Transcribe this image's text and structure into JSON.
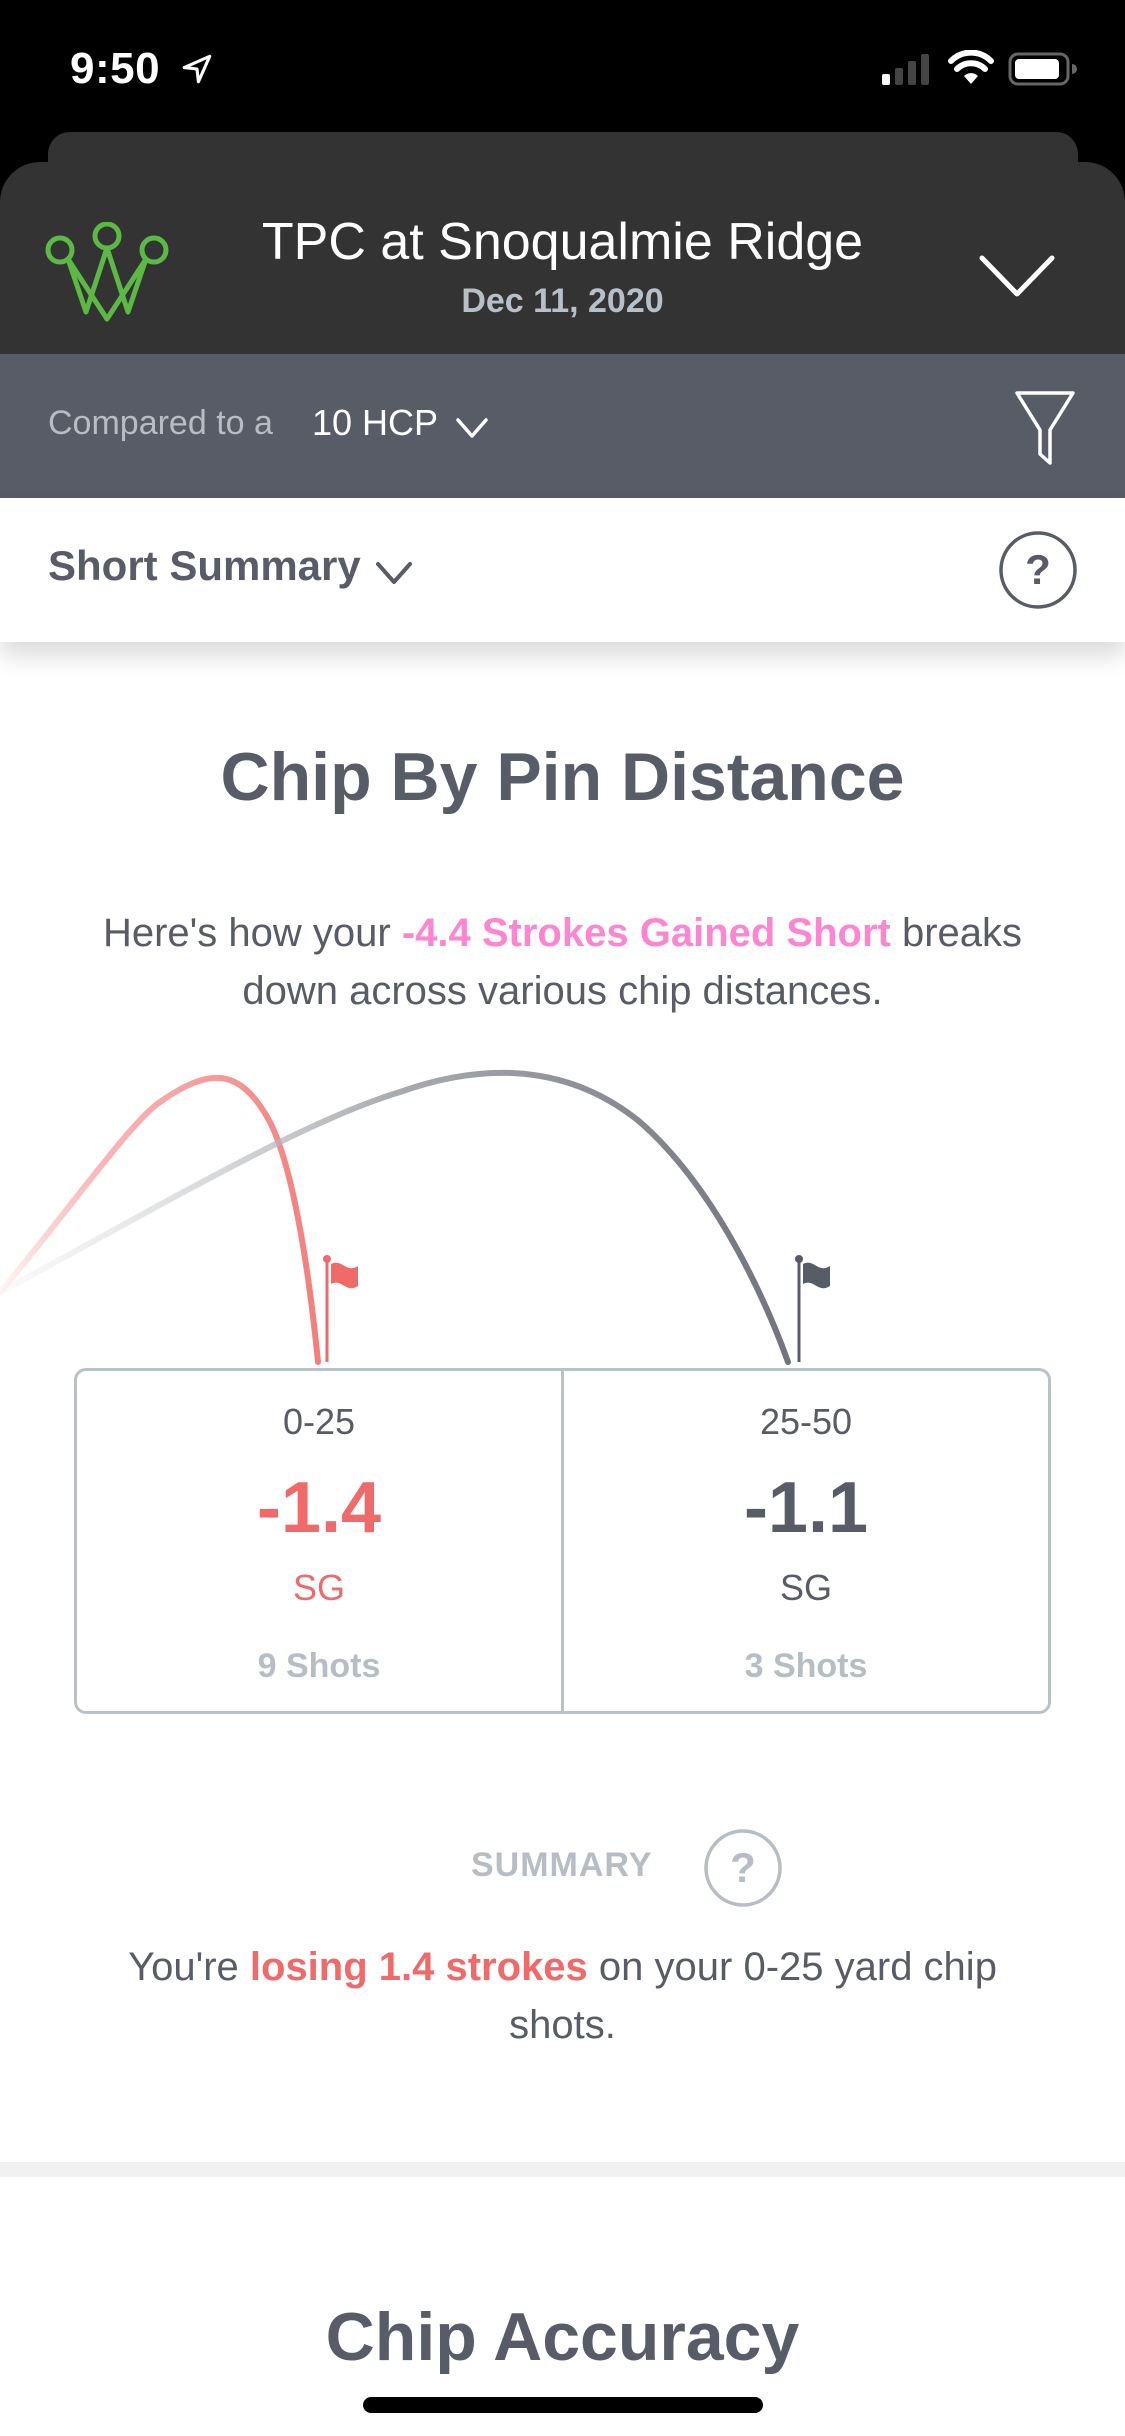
{
  "status_bar": {
    "time": "9:50",
    "icons": [
      "location-arrow-icon",
      "cellular-signal-icon",
      "wifi-icon",
      "battery-icon"
    ]
  },
  "header": {
    "logo": "crown-logo-icon",
    "course_name": "TPC at Snoqualmie Ridge",
    "date": "Dec 11, 2020",
    "expand_icon": "chevron-down-icon"
  },
  "compare": {
    "label": "Compared to a",
    "value": "10 HCP",
    "filter_icon": "filter-funnel-icon"
  },
  "view_selector": {
    "label": "Short Summary",
    "help_icon": "help-circle-icon"
  },
  "chip_by_pin": {
    "title": "Chip By Pin Distance",
    "intro_prefix": "Here's how your ",
    "intro_highlight": "-4.4 Strokes Gained Short",
    "intro_suffix": " breaks down across various chip distances.",
    "stats": [
      {
        "range": "0-25",
        "value": "-1.4",
        "unit": "SG",
        "shots": "9 Shots",
        "color": "#f06a6a"
      },
      {
        "range": "25-50",
        "value": "-1.1",
        "unit": "SG",
        "shots": "3 Shots",
        "color": "#585c66"
      }
    ],
    "summary_heading": "SUMMARY",
    "summary_prefix": "You're ",
    "summary_highlight": "losing 1.4 strokes",
    "summary_suffix": " on your 0-25 yard chip shots."
  },
  "chip_accuracy": {
    "title": "Chip Accuracy"
  },
  "colors": {
    "accent_green": "#5cb944",
    "negative_red": "#f06a6a",
    "highlight_pink": "#ff85d0",
    "text_dark": "#585c66",
    "text_muted": "#b6bdc4",
    "header_bg": "#333333",
    "compare_bg": "#585c66"
  }
}
